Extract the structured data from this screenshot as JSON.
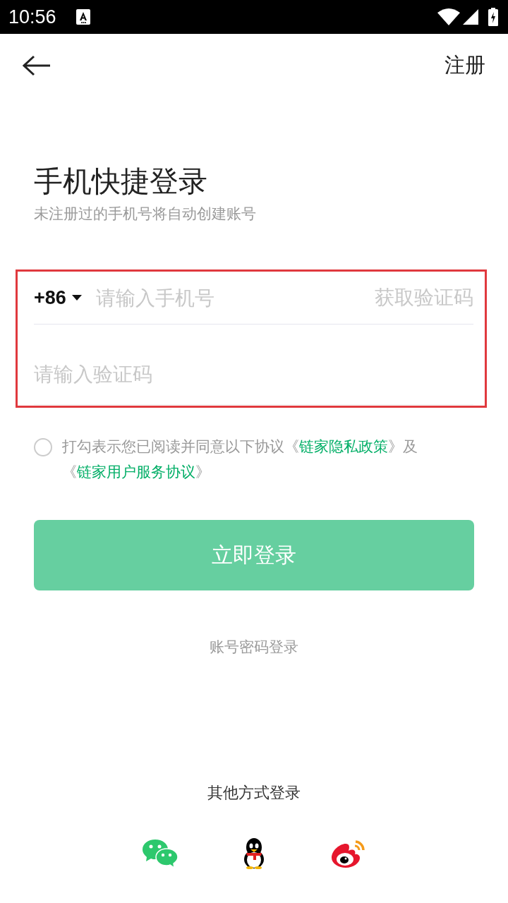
{
  "status_bar": {
    "time": "10:56"
  },
  "header": {
    "action": "注册"
  },
  "title": "手机快捷登录",
  "subtitle": "未注册过的手机号将自动创建账号",
  "phone": {
    "country_code": "+86",
    "placeholder": "请输入手机号",
    "get_code": "获取验证码"
  },
  "code": {
    "placeholder": "请输入验证码"
  },
  "agreement": {
    "checked": false,
    "segments": [
      {
        "kind": "text",
        "text": "打勾表示您已阅读并同意以下协议《"
      },
      {
        "kind": "link",
        "text": "链家隐私政策"
      },
      {
        "kind": "text",
        "text": "》及《"
      },
      {
        "kind": "link",
        "text": "链家用户服务协议"
      },
      {
        "kind": "text",
        "text": "》"
      }
    ]
  },
  "login_button": {
    "label": "立即登录",
    "disabled": true
  },
  "password_login": "账号密码登录",
  "other_login": {
    "title": "其他方式登录",
    "methods": [
      {
        "kind": "chat"
      },
      {
        "kind": "penguin"
      },
      {
        "kind": "eye"
      }
    ]
  }
}
